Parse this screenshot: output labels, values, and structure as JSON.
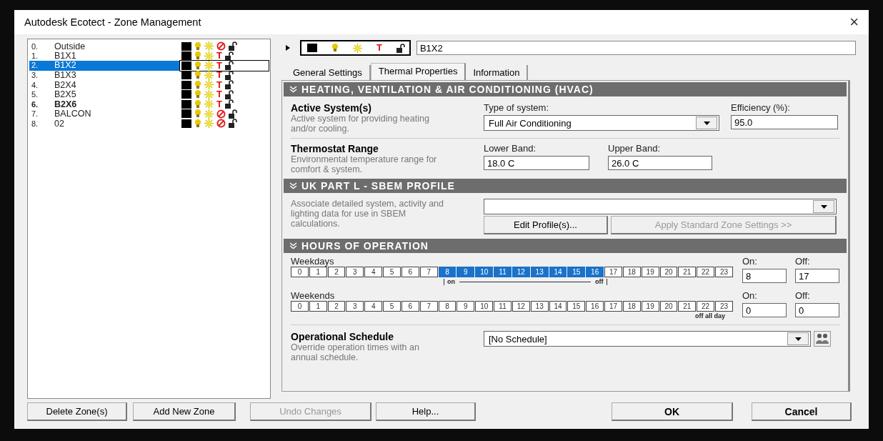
{
  "window": {
    "title": "Autodesk Ecotect - Zone Management",
    "close": "×"
  },
  "zones": [
    {
      "number": "0.",
      "name": "Outside",
      "selected": false,
      "bold": false,
      "thermal": false
    },
    {
      "number": "1.",
      "name": "B1X1",
      "selected": false,
      "bold": false,
      "thermal": true,
      "mark": "T"
    },
    {
      "number": "2.",
      "name": "B1X2",
      "selected": true,
      "bold": false,
      "thermal": true,
      "mark": "T"
    },
    {
      "number": "3.",
      "name": "B1X3",
      "selected": false,
      "bold": false,
      "thermal": true,
      "mark": "T"
    },
    {
      "number": "4.",
      "name": "B2X4",
      "selected": false,
      "bold": false,
      "thermal": true,
      "mark": "T"
    },
    {
      "number": "5.",
      "name": "B2X5",
      "selected": false,
      "bold": false,
      "thermal": true,
      "mark": "T"
    },
    {
      "number": "6.",
      "name": "B2X6",
      "selected": false,
      "bold": true,
      "thermal": true,
      "mark": "T"
    },
    {
      "number": "7.",
      "name": "BALCON",
      "selected": false,
      "bold": false,
      "thermal": false
    },
    {
      "number": "8.",
      "name": "02",
      "selected": false,
      "bold": false,
      "thermal": false
    }
  ],
  "zone_toolbar": {
    "mark": "T",
    "name_value": "B1X2"
  },
  "tabs": [
    {
      "label": "General Settings",
      "selected": false
    },
    {
      "label": "Thermal Properties",
      "selected": true
    },
    {
      "label": "Information",
      "selected": false
    }
  ],
  "hvac": {
    "header": "HEATING, VENTILATION & AIR CONDITIONING (HVAC)",
    "title": "Active System(s)",
    "description": "Active system for providing heating and/or cooling.",
    "type_label": "Type of system:",
    "type_value": "Full Air Conditioning",
    "efficiency_label": "Efficiency (%):",
    "efficiency_value": "95.0",
    "thermostat_title": "Thermostat Range",
    "thermostat_description": "Environmental temperature range for comfort & system.",
    "lower_label": "Lower Band:",
    "lower_value": "18.0 C",
    "upper_label": "Upper Band:",
    "upper_value": "26.0 C"
  },
  "sbem": {
    "header": "UK PART L - SBEM PROFILE",
    "description": "Associate detailed system, activity and lighting data for use in SBEM calculations.",
    "edit_button": "Edit Profile(s)...",
    "apply_button": {
      "label": "Apply Standard Zone Settings >>",
      "disabled": true
    }
  },
  "hours": {
    "header": "HOURS OF OPERATION",
    "rows": [
      {
        "label": "Weekdays",
        "on_label": "On:",
        "off_label": "Off:",
        "on": "8",
        "off": "17",
        "note_on": "on",
        "note_off": "off",
        "cells": [
          {
            "label": "0",
            "selected": false
          },
          {
            "label": "1",
            "selected": false
          },
          {
            "label": "2",
            "selected": false
          },
          {
            "label": "3",
            "selected": false
          },
          {
            "label": "4",
            "selected": false
          },
          {
            "label": "5",
            "selected": false
          },
          {
            "label": "6",
            "selected": false
          },
          {
            "label": "7",
            "selected": false
          },
          {
            "label": "8",
            "selected": true
          },
          {
            "label": "9",
            "selected": true
          },
          {
            "label": "10",
            "selected": true
          },
          {
            "label": "11",
            "selected": true
          },
          {
            "label": "12",
            "selected": true
          },
          {
            "label": "13",
            "selected": true
          },
          {
            "label": "14",
            "selected": true
          },
          {
            "label": "15",
            "selected": true
          },
          {
            "label": "16",
            "selected": true
          },
          {
            "label": "17",
            "selected": false
          },
          {
            "label": "18",
            "selected": false
          },
          {
            "label": "19",
            "selected": false
          },
          {
            "label": "20",
            "selected": false
          },
          {
            "label": "21",
            "selected": false
          },
          {
            "label": "22",
            "selected": false
          },
          {
            "label": "23",
            "selected": false
          }
        ]
      },
      {
        "label": "Weekends",
        "on_label": "On:",
        "off_label": "Off:",
        "on": "0",
        "off": "0",
        "note_all": "off all day",
        "cells": [
          {
            "label": "0",
            "selected": false
          },
          {
            "label": "1",
            "selected": false
          },
          {
            "label": "2",
            "selected": false
          },
          {
            "label": "3",
            "selected": false
          },
          {
            "label": "4",
            "selected": false
          },
          {
            "label": "5",
            "selected": false
          },
          {
            "label": "6",
            "selected": false
          },
          {
            "label": "7",
            "selected": false
          },
          {
            "label": "8",
            "selected": false
          },
          {
            "label": "9",
            "selected": false
          },
          {
            "label": "10",
            "selected": false
          },
          {
            "label": "11",
            "selected": false
          },
          {
            "label": "12",
            "selected": false
          },
          {
            "label": "13",
            "selected": false
          },
          {
            "label": "14",
            "selected": false
          },
          {
            "label": "15",
            "selected": false
          },
          {
            "label": "16",
            "selected": false
          },
          {
            "label": "17",
            "selected": false
          },
          {
            "label": "18",
            "selected": false
          },
          {
            "label": "19",
            "selected": false
          },
          {
            "label": "20",
            "selected": false
          },
          {
            "label": "21",
            "selected": false
          },
          {
            "label": "22",
            "selected": false
          },
          {
            "label": "23",
            "selected": false
          }
        ]
      }
    ]
  },
  "schedule": {
    "title": "Operational Schedule",
    "description": "Override operation times with an annual schedule.",
    "value": "[No Schedule]"
  },
  "buttons": [
    {
      "label": "Delete Zone(s)",
      "kind": "normal",
      "disabled": false
    },
    {
      "label": "Add New Zone",
      "kind": "normal",
      "disabled": false
    },
    {
      "label": "Undo Changes",
      "kind": "normal",
      "disabled": true
    },
    {
      "label": "Help...",
      "kind": "normal",
      "disabled": false
    },
    {
      "label": "OK",
      "kind": "default",
      "disabled": false
    },
    {
      "label": "Cancel",
      "kind": "default",
      "disabled": false
    }
  ]
}
